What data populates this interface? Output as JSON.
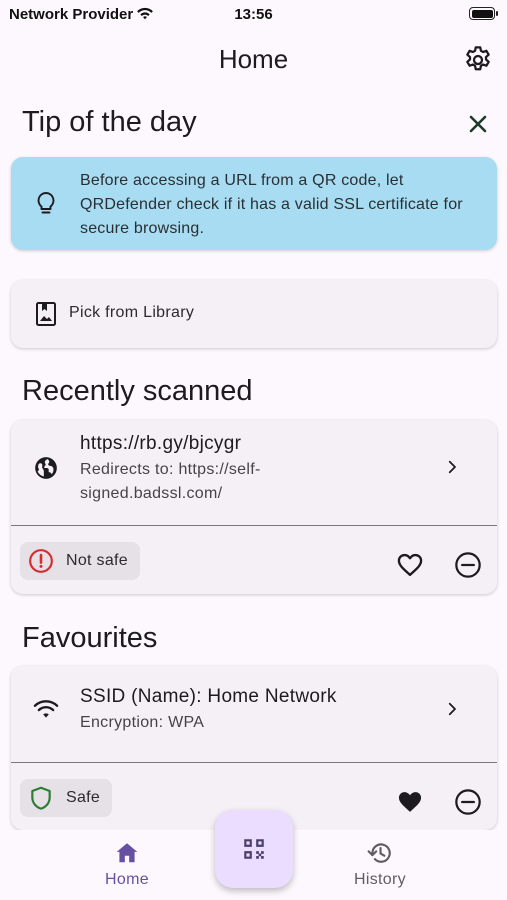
{
  "status_bar": {
    "carrier": "Network Provider",
    "time": "13:56"
  },
  "header": {
    "title": "Home",
    "settings_icon": "gear-icon"
  },
  "tip": {
    "heading": "Tip of the day",
    "text": "Before accessing a URL from a QR code, let QRDefender check if it has a valid SSL certificate for secure browsing.",
    "icon": "lightbulb-icon",
    "close_icon": "close-icon"
  },
  "pick": {
    "label": "Pick from Library",
    "icon": "image-library-icon"
  },
  "recent": {
    "heading": "Recently scanned",
    "items": [
      {
        "icon": "globe-icon",
        "title": "https://rb.gy/bjcygr",
        "subtitle": "Redirects to: https://self-signed.badssl.com/",
        "status": "Not safe",
        "status_icon": "warning-circle-icon",
        "status_color": "#d32f2f",
        "favourited": false
      }
    ]
  },
  "favourites": {
    "heading": "Favourites",
    "items": [
      {
        "icon": "wifi-icon",
        "title": "SSID (Name): Home Network",
        "subtitle": "Encryption: WPA",
        "status": "Safe",
        "status_icon": "shield-icon",
        "status_color": "#2e7d32",
        "favourited": true
      }
    ]
  },
  "bottom_nav": {
    "items": [
      {
        "label": "Home",
        "icon": "home-icon",
        "active": true
      },
      {
        "label": "History",
        "icon": "history-icon",
        "active": false
      }
    ],
    "fab_icon": "qr-code-icon"
  },
  "colors": {
    "accent": "#6750a4",
    "tip_background": "#a7dcf2",
    "card_background": "#f5f0f6",
    "fab_background": "#eaddff"
  }
}
